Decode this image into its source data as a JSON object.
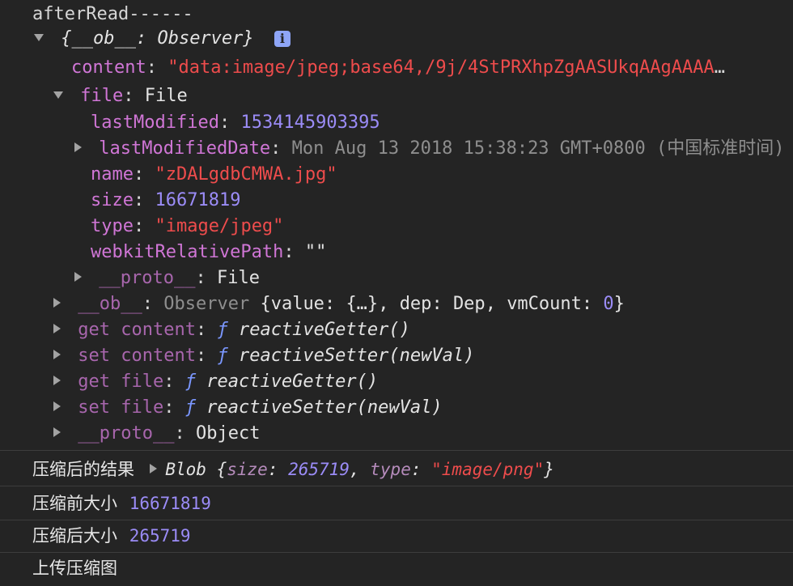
{
  "lines": {
    "header": "afterRead------",
    "obj_open": "{__ob__: Observer}",
    "content_key": "content",
    "content_val": "\"data:image/jpeg;base64,/9j/4StPRXhpZgAASUkqAAgAAAA",
    "ellipsis": "…",
    "file_key": "file",
    "file_val": "File",
    "lastModified_key": "lastModified",
    "lastModified_val": "1534145903395",
    "lastModifiedDate_key": "lastModifiedDate",
    "lastModifiedDate_val": "Mon Aug 13 2018 15:38:23 GMT+0800 (中国标准时间)",
    "name_key": "name",
    "name_val": "\"zDALgdbCMWA.jpg\"",
    "size_key": "size",
    "size_val": "16671819",
    "type_key": "type",
    "type_val": "\"image/jpeg\"",
    "wrp_key": "webkitRelativePath",
    "wrp_val": "\"\"",
    "proto_key": "__proto__",
    "proto_file_val": "File",
    "ob_key": "__ob__",
    "ob_type": "Observer",
    "ob_value_key": "value",
    "ob_value_val": "{…}",
    "ob_dep_key": "dep",
    "ob_dep_val": "Dep",
    "ob_vm_key": "vmCount",
    "ob_vm_val": "0",
    "get_content": "get content",
    "set_content": "set content",
    "get_file": "get file",
    "set_file": "set file",
    "f": "ƒ",
    "getter": "reactiveGetter()",
    "setter": "reactiveSetter(newVal)",
    "proto_obj_val": "Object"
  },
  "logs": {
    "compressed_result_label": "压缩后的结果",
    "blob_prefix": "Blob {",
    "blob_size_key": "size",
    "blob_size_val": "265719",
    "blob_type_key": "type",
    "blob_type_val": "\"image/png\"",
    "blob_suffix": "}",
    "before_label": "压缩前大小",
    "before_val": "16671819",
    "after_label": "压缩后大小",
    "after_val": "265719",
    "upload_label": "上传压缩图"
  },
  "icons": {
    "info": "i"
  },
  "colors": {
    "background": "#242424",
    "key": "#d076d6",
    "string": "#ee4c4c",
    "number": "#9b8cf7"
  }
}
